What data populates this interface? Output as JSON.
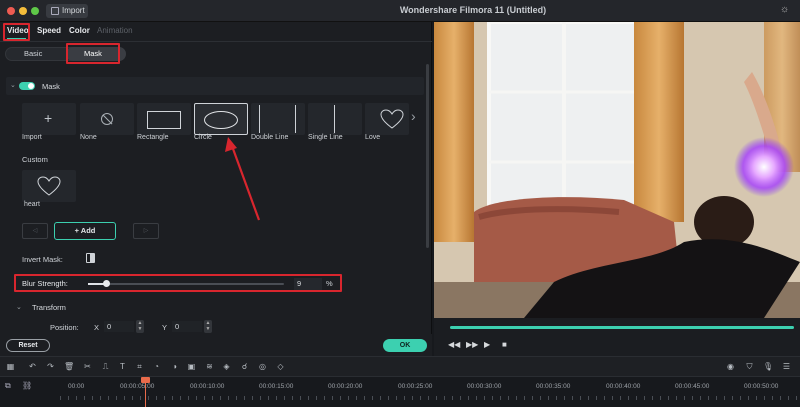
{
  "window": {
    "title": "Wondershare Filmora 11 (Untitled)",
    "import_label": "Import"
  },
  "tabs": [
    {
      "label": "Video",
      "active": true
    },
    {
      "label": "Speed",
      "active": false
    },
    {
      "label": "Color",
      "active": false
    },
    {
      "label": "Animation",
      "active": false
    }
  ],
  "subtabs": [
    {
      "label": "Basic",
      "active": false
    },
    {
      "label": "Mask",
      "active": true
    }
  ],
  "mask_section": {
    "label": "Mask",
    "enabled": true,
    "shapes": [
      {
        "label": "Import",
        "icon": "plus-icon"
      },
      {
        "label": "None",
        "icon": "none-icon"
      },
      {
        "label": "Rectangle",
        "icon": "rectangle-icon"
      },
      {
        "label": "Circle",
        "icon": "circle-icon",
        "selected": true
      },
      {
        "label": "Double Line",
        "icon": "double-line-icon"
      },
      {
        "label": "Single Line",
        "icon": "single-line-icon"
      },
      {
        "label": "Love",
        "icon": "heart-icon"
      }
    ],
    "custom_label": "Custom",
    "custom_items": [
      {
        "label": "heart",
        "icon": "heart-icon"
      }
    ],
    "add_label": "Add",
    "invert_label": "Invert Mask:",
    "blur_label": "Blur Strength:",
    "blur_value": "9",
    "blur_unit": "%",
    "blur_fraction": 0.09
  },
  "transform": {
    "label": "Transform",
    "position_label": "Position:",
    "x_label": "X",
    "x_value": "0",
    "y_label": "Y",
    "y_value": "0"
  },
  "footer": {
    "reset_label": "Reset",
    "ok_label": "OK"
  },
  "timeline": {
    "ticks": [
      "00:00",
      "00:00:05:00",
      "00:00:10:00",
      "00:00:15:00",
      "00:00:20:00",
      "00:00:25:00",
      "00:00:30:00",
      "00:00:35:00",
      "00:00:40:00",
      "00:00:45:00",
      "00:00:50:00"
    ]
  },
  "colors": {
    "accent": "#3cd0b0",
    "highlight": "#d8262e",
    "playhead": "#e96b4b"
  }
}
